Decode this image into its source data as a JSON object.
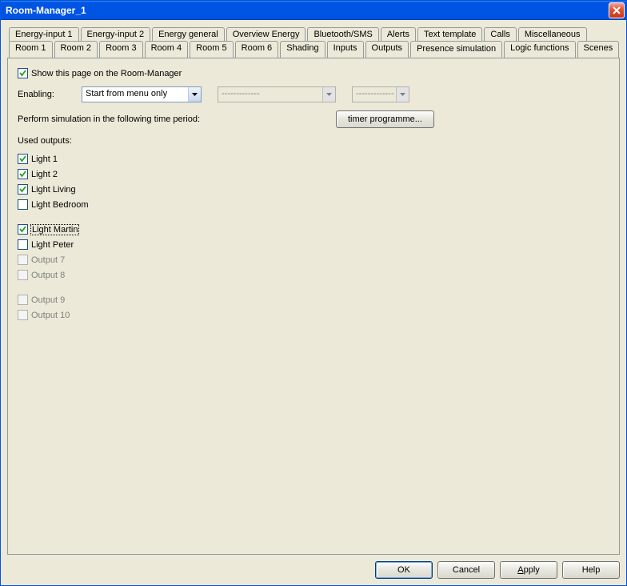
{
  "window": {
    "title": "Room-Manager_1"
  },
  "tabs_row1": [
    "Energy-input 1",
    "Energy-input 2",
    "Energy general",
    "Overview Energy",
    "Bluetooth/SMS",
    "Alerts",
    "Text template",
    "Calls",
    "Miscellaneous"
  ],
  "tabs_row2": [
    "Room 1",
    "Room 2",
    "Room 3",
    "Room 4",
    "Room 5",
    "Room 6",
    "Shading",
    "Inputs",
    "Outputs",
    "Presence simulation",
    "Logic functions",
    "Scenes"
  ],
  "active_tab": "Presence simulation",
  "page": {
    "show_label": "Show this page on the Room-Manager",
    "show_checked": true,
    "enabling_label": "Enabling:",
    "enabling_value": "Start from menu only",
    "combo2_value": "-------------",
    "combo3_value": "-------------",
    "perform_label": "Perform simulation in the following time period:",
    "timer_btn": "timer programme...",
    "used_label": "Used outputs:",
    "outputs": [
      {
        "label": "Light 1",
        "checked": true,
        "enabled": true
      },
      {
        "label": "Light 2",
        "checked": true,
        "enabled": true
      },
      {
        "label": "Light Living",
        "checked": true,
        "enabled": true
      },
      {
        "label": "Light Bedroom",
        "checked": false,
        "enabled": true
      },
      {
        "label": "Light Martin",
        "checked": true,
        "enabled": true,
        "focused": true
      },
      {
        "label": "Light Peter",
        "checked": false,
        "enabled": true
      },
      {
        "label": "Output 7",
        "checked": false,
        "enabled": false
      },
      {
        "label": "Output 8",
        "checked": false,
        "enabled": false
      },
      {
        "label": "Output 9",
        "checked": false,
        "enabled": false
      },
      {
        "label": "Output 10",
        "checked": false,
        "enabled": false
      }
    ]
  },
  "buttons": {
    "ok": "OK",
    "cancel": "Cancel",
    "apply": "Apply",
    "help": "Help"
  }
}
